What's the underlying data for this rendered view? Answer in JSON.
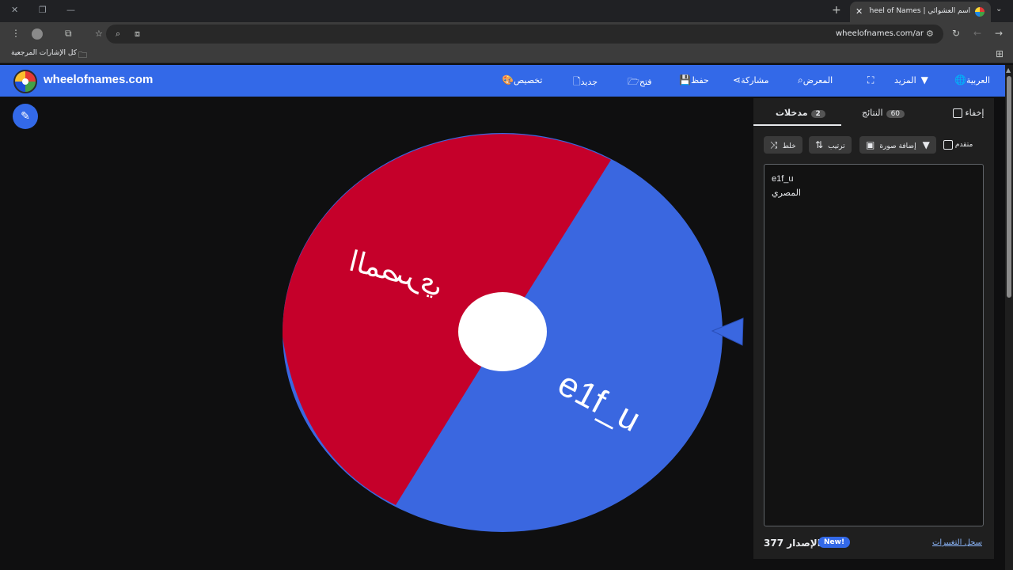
{
  "browser": {
    "window_controls": [
      "✕",
      "❐",
      "—"
    ],
    "tab": {
      "title": "اسم العشوائي | Wheel of Names",
      "close": "✕"
    },
    "new_tab": "+",
    "tab_search": "⌄",
    "url": "wheelofnames.com/ar",
    "bookmarks": {
      "all_bookmarks": "كل الإشارات المرجعية"
    }
  },
  "site": {
    "brand": "wheelofnames.com",
    "nav": {
      "language": "العربية",
      "more": "المزيد",
      "gallery": "المعرض",
      "share": "مشاركة",
      "save": "حفظ",
      "open": "فتح",
      "new": "جديد",
      "customize": "تخصيص"
    }
  },
  "wheel": {
    "slices": [
      {
        "label": "e1f_u",
        "color": "#3a67e0"
      },
      {
        "label": "المصري",
        "color": "#c5002a"
      }
    ],
    "pointer_color": "#3a67e0"
  },
  "panel": {
    "tabs": {
      "entries_label": "مدخلات",
      "entries_count": "2",
      "results_label": "النتائج",
      "results_count": "60",
      "hide_label": "إخفاء"
    },
    "actions": {
      "shuffle": "خلط",
      "sort": "ترتيب",
      "add_image": "إضافة صورة",
      "advanced": "متقدم"
    },
    "entries": [
      "e1f_u",
      "المصري"
    ],
    "footer": {
      "version": "الإصدار 377",
      "new_badge": "New!",
      "changelog": "سجل التغييرات"
    }
  },
  "icons": {
    "edit": "pencil-icon",
    "shuffle": "shuffle-icon",
    "sort": "sort-icon",
    "image": "image-icon"
  }
}
